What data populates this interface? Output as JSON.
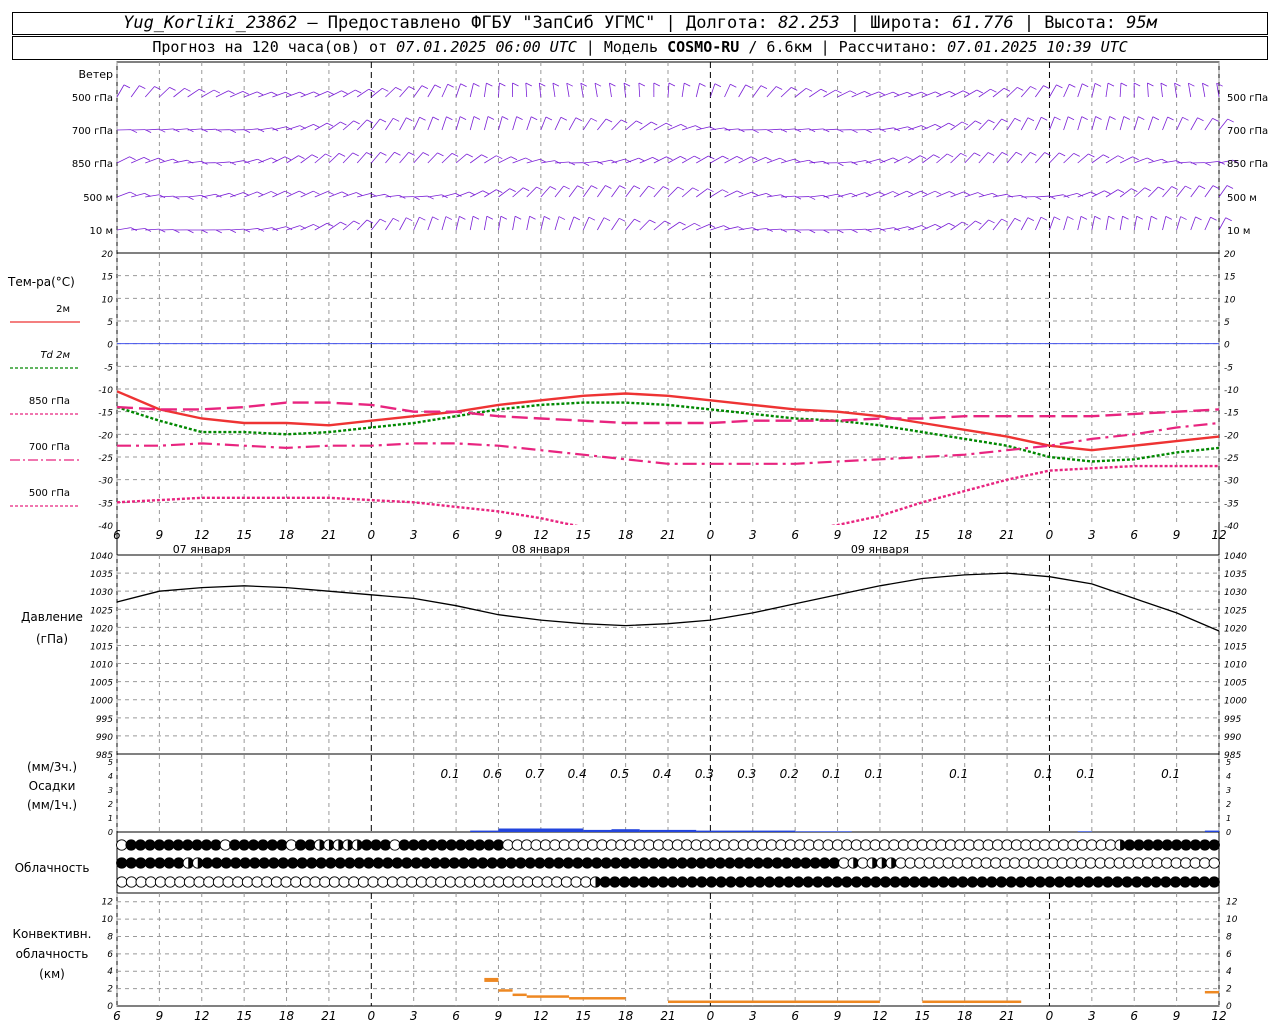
{
  "header": {
    "line1": {
      "station": "Yug_Korliki_23862",
      "provider": " – Предоставлено ФГБУ \"ЗапСиб УГМС\" | Долгота: ",
      "lon": "82.253",
      "lat_label": " | Широта: ",
      "lat": "61.776",
      "alt_label": " | Высота: ",
      "alt": "95м"
    },
    "line2": {
      "prefix": "Прогноз на 120 часа(ов) от ",
      "init": "07.01.2025 06:00 UTC",
      "model_label": "  | Модель ",
      "model": "COSMO-RU",
      "grid": " / 6.6км | Рассчитано: ",
      "computed": "07.01.2025 10:39 UTC"
    }
  },
  "colors": {
    "wind": "#7a1fd6",
    "t2m": "#ee3333",
    "td2m": "#008800",
    "t850": "#e8247f",
    "t700": "#e8247f",
    "t500": "#e8247f",
    "zero": "#4455ee",
    "pressure": "#000000",
    "precip": "#2244dd",
    "conv": "#ee8822",
    "grid": "#999999"
  },
  "labels": {
    "wind": "Ветер",
    "wind_levels": [
      "500 гПа",
      "700 гПа",
      "850 гПа",
      "500 м",
      "10  м"
    ],
    "temp_title": "Тем-ра(°С)",
    "temp_legend": [
      "2м",
      "Td 2м",
      "850 гПа",
      "700 гПа",
      "500 гПа"
    ],
    "pressure": [
      "Давление",
      "(гПа)"
    ],
    "precip": [
      "(мм/3ч.)",
      "Осадки",
      "(мм/1ч.)"
    ],
    "cloud": "Облачность",
    "conv": [
      "Конвективн.",
      "облачность",
      "(км)"
    ]
  },
  "time_axis": {
    "ticks": [
      "6",
      "9",
      "12",
      "15",
      "18",
      "21",
      "0",
      "3",
      "6",
      "9",
      "12",
      "15",
      "18",
      "21",
      "0",
      "3",
      "6",
      "9",
      "12",
      "15",
      "18",
      "21",
      "0",
      "3",
      "6",
      "9",
      "12"
    ],
    "days": [
      "07 января",
      "08 января",
      "09 января"
    ]
  },
  "chart_data": [
    {
      "type": "line",
      "name": "temperature",
      "ylim": [
        -40,
        20
      ],
      "yticks": [
        20,
        15,
        10,
        5,
        0,
        -5,
        -10,
        -15,
        -20,
        -25,
        -30,
        -35,
        -40
      ],
      "x_hours": [
        0,
        3,
        6,
        9,
        12,
        15,
        18,
        21,
        24,
        27,
        30,
        33,
        36,
        39,
        42,
        45,
        48,
        51,
        54,
        57,
        60,
        63,
        66,
        69,
        72,
        75,
        78
      ],
      "series": [
        {
          "name": "2м",
          "values": [
            -10.5,
            -14.5,
            -16.5,
            -17.5,
            -17.5,
            -18,
            -17,
            -16,
            -15,
            -13.5,
            -12.5,
            -11.5,
            -11,
            -11.5,
            -12.5,
            -13.5,
            -14.5,
            -15,
            -16,
            -17.5,
            -19,
            -20.5,
            -22.5,
            -23.5,
            -22.5,
            -21.5,
            -20.5
          ]
        },
        {
          "name": "Td 2м",
          "values": [
            -14,
            -17,
            -19.5,
            -19.5,
            -20,
            -19.5,
            -18.5,
            -17.5,
            -16,
            -14.5,
            -13.5,
            -13,
            -13,
            -13.5,
            -14.5,
            -15.5,
            -16.5,
            -17,
            -18,
            -19.5,
            -21,
            -22.5,
            -25,
            -26,
            -25.5,
            -24,
            -23
          ]
        },
        {
          "name": "850 гПа",
          "values": [
            -14,
            -14.5,
            -14.5,
            -14,
            -13,
            -13,
            -13.5,
            -15,
            -15,
            -16,
            -16.5,
            -17,
            -17.5,
            -17.5,
            -17.5,
            -17,
            -17,
            -17,
            -16.5,
            -16.5,
            -16,
            -16,
            -16,
            -16,
            -15.5,
            -15,
            -14.5
          ]
        },
        {
          "name": "700 гПа",
          "values": [
            -22.5,
            -22.5,
            -22,
            -22.5,
            -23,
            -22.5,
            -22.5,
            -22,
            -22,
            -22.5,
            -23.5,
            -24.5,
            -25.5,
            -26.5,
            -26.5,
            -26.5,
            -26.5,
            -26,
            -25.5,
            -25,
            -24.5,
            -23.5,
            -22.5,
            -21,
            -20,
            -18.5,
            -17.5
          ]
        },
        {
          "name": "500 гПа",
          "values": [
            -35,
            -34.5,
            -34,
            -34,
            -34,
            -34,
            -34.5,
            -35,
            -36,
            -37,
            -38.5,
            -40.5,
            -43,
            -44,
            -44,
            -43,
            -41.5,
            -40,
            -38,
            -35,
            -32.5,
            -30,
            -28,
            -27.5,
            -27,
            -27,
            -27
          ]
        }
      ]
    },
    {
      "type": "line",
      "name": "pressure",
      "ylim": [
        985,
        1040
      ],
      "yticks": [
        1040,
        1035,
        1030,
        1025,
        1020,
        1015,
        1010,
        1005,
        1000,
        995,
        990,
        985
      ],
      "x_hours": [
        0,
        3,
        6,
        9,
        12,
        15,
        18,
        21,
        24,
        27,
        30,
        33,
        36,
        39,
        42,
        45,
        48,
        51,
        54,
        57,
        60,
        63,
        66,
        69,
        72,
        75,
        78
      ],
      "values": [
        1027,
        1030,
        1031,
        1031.5,
        1031,
        1030,
        1029,
        1028,
        1026,
        1023.5,
        1022,
        1021,
        1020.5,
        1021,
        1022,
        1024,
        1026.5,
        1029,
        1031.5,
        1033.5,
        1034.5,
        1035,
        1034,
        1032,
        1028,
        1024,
        1019
      ]
    },
    {
      "type": "bar",
      "name": "precipitation",
      "ylim": [
        0,
        5
      ],
      "yticks": [
        5,
        4,
        3,
        2,
        1,
        0
      ],
      "labels_3h": [
        {
          "hour": 24,
          "text": "0.1"
        },
        {
          "hour": 27,
          "text": "0.6"
        },
        {
          "hour": 30,
          "text": "0.7"
        },
        {
          "hour": 33,
          "text": "0.4"
        },
        {
          "hour": 36,
          "text": "0.5"
        },
        {
          "hour": 39,
          "text": "0.4"
        },
        {
          "hour": 42,
          "text": "0.3"
        },
        {
          "hour": 45,
          "text": "0.3"
        },
        {
          "hour": 48,
          "text": "0.2"
        },
        {
          "hour": 51,
          "text": "0.1"
        },
        {
          "hour": 54,
          "text": "0.1"
        },
        {
          "hour": 60,
          "text": "0.1"
        },
        {
          "hour": 66,
          "text": "0.1"
        },
        {
          "hour": 69,
          "text": "0.1"
        },
        {
          "hour": 75,
          "text": "0.1"
        }
      ],
      "hourly": [
        {
          "h0": 25,
          "h1": 27,
          "v": 0.1
        },
        {
          "h0": 27,
          "h1": 33,
          "v": 0.25
        },
        {
          "h0": 33,
          "h1": 35,
          "v": 0.15
        },
        {
          "h0": 35,
          "h1": 37,
          "v": 0.2
        },
        {
          "h0": 37,
          "h1": 41,
          "v": 0.15
        },
        {
          "h0": 41,
          "h1": 48,
          "v": 0.1
        },
        {
          "h0": 48,
          "h1": 52,
          "v": 0.05
        },
        {
          "h0": 68,
          "h1": 69,
          "v": 0.05
        },
        {
          "h0": 77,
          "h1": 78,
          "v": 0.1
        }
      ]
    },
    {
      "type": "table",
      "name": "cloudiness",
      "rows": [
        "0ffffffffff ffffff ffcccccfff fffffffffff00000000000000000000000000000000000000000000000000000000000000000cffffffffff",
        "fffffffccfffffffffffffffffffffffffffffffffffffffffffffffffffffffffffffffffff0c0ccc0000000000000000000000000000000000",
        "0000000000000000000000000000000000000000000000000cffffffffffffffffffffffffffffffffffffffffffffffffffffffffffffffff"
      ]
    },
    {
      "type": "bar",
      "name": "convective_cloud",
      "ylim": [
        0,
        13
      ],
      "yticks": [
        12,
        10,
        8,
        6,
        4,
        2,
        0
      ],
      "segments": [
        {
          "h0": 26,
          "h1": 27,
          "v": 3
        },
        {
          "h0": 27,
          "h1": 28,
          "v": 1.7
        },
        {
          "h0": 28,
          "h1": 29,
          "v": 1.2
        },
        {
          "h0": 29,
          "h1": 32,
          "v": 1
        },
        {
          "h0": 32,
          "h1": 36,
          "v": 0.8
        },
        {
          "h0": 39,
          "h1": 54,
          "v": 0.4
        },
        {
          "h0": 57,
          "h1": 64,
          "v": 0.4
        },
        {
          "h0": 77,
          "h1": 78,
          "v": 1.5
        }
      ]
    }
  ]
}
